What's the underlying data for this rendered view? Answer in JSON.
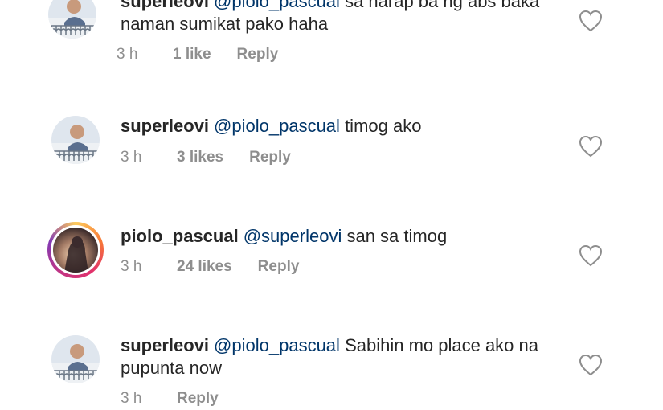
{
  "comments": [
    {
      "username": "superleovi",
      "mention": "@piolo_pascual",
      "text": "sa harap ba ng abs baka naman sumikat pako haha",
      "time": "3 h",
      "likes": "1 like",
      "reply": "Reply",
      "avatar": "superleovi-avatar",
      "heart_icon": "heart-outline-icon"
    },
    {
      "username": "superleovi",
      "mention": "@piolo_pascual",
      "text": "timog ako",
      "time": "3 h",
      "likes": "3 likes",
      "reply": "Reply",
      "avatar": "superleovi-avatar",
      "heart_icon": "heart-outline-icon"
    },
    {
      "username": "piolo_pascual",
      "mention": "@superleovi",
      "text": "san sa timog",
      "time": "3 h",
      "likes": "24 likes",
      "reply": "Reply",
      "avatar": "piolo_pascual-avatar-story-ring",
      "heart_icon": "heart-outline-icon"
    },
    {
      "username": "superleovi",
      "mention": "@piolo_pascual",
      "text": "Sabihin mo place ako na pupunta now",
      "time": "3 h",
      "likes": "",
      "reply": "Reply",
      "avatar": "superleovi-avatar",
      "heart_icon": "heart-outline-icon"
    }
  ],
  "colors": {
    "text": "#262626",
    "mention": "#003569",
    "meta": "#8e8e8e",
    "heart_stroke": "#8e8e8e"
  }
}
